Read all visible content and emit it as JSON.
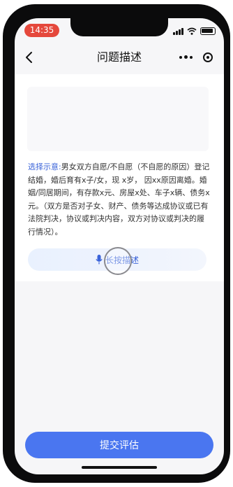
{
  "status_bar": {
    "time": "14:35"
  },
  "nav": {
    "title": "问题描述"
  },
  "main": {
    "hint_prefix": "选择示意:",
    "hint_body": "男女双方自愿/不自愿（不自愿的原因）登记结婚，婚后育有x子/女，现 x岁， 因xx原因离婚。婚姻/同居期间，有存款x元、房屋x处、车子x辆、债务x元。（双方是否对子女、财产、债务等达成协议或已有法院判决，协议或判决内容，双方对协议或判决的履行情况）。",
    "voice_label": "长按描述"
  },
  "footer": {
    "submit_label": "提交评估"
  },
  "colors": {
    "accent": "#4a76f0",
    "link": "#3a63d9",
    "time_pill": "#e5483c"
  }
}
